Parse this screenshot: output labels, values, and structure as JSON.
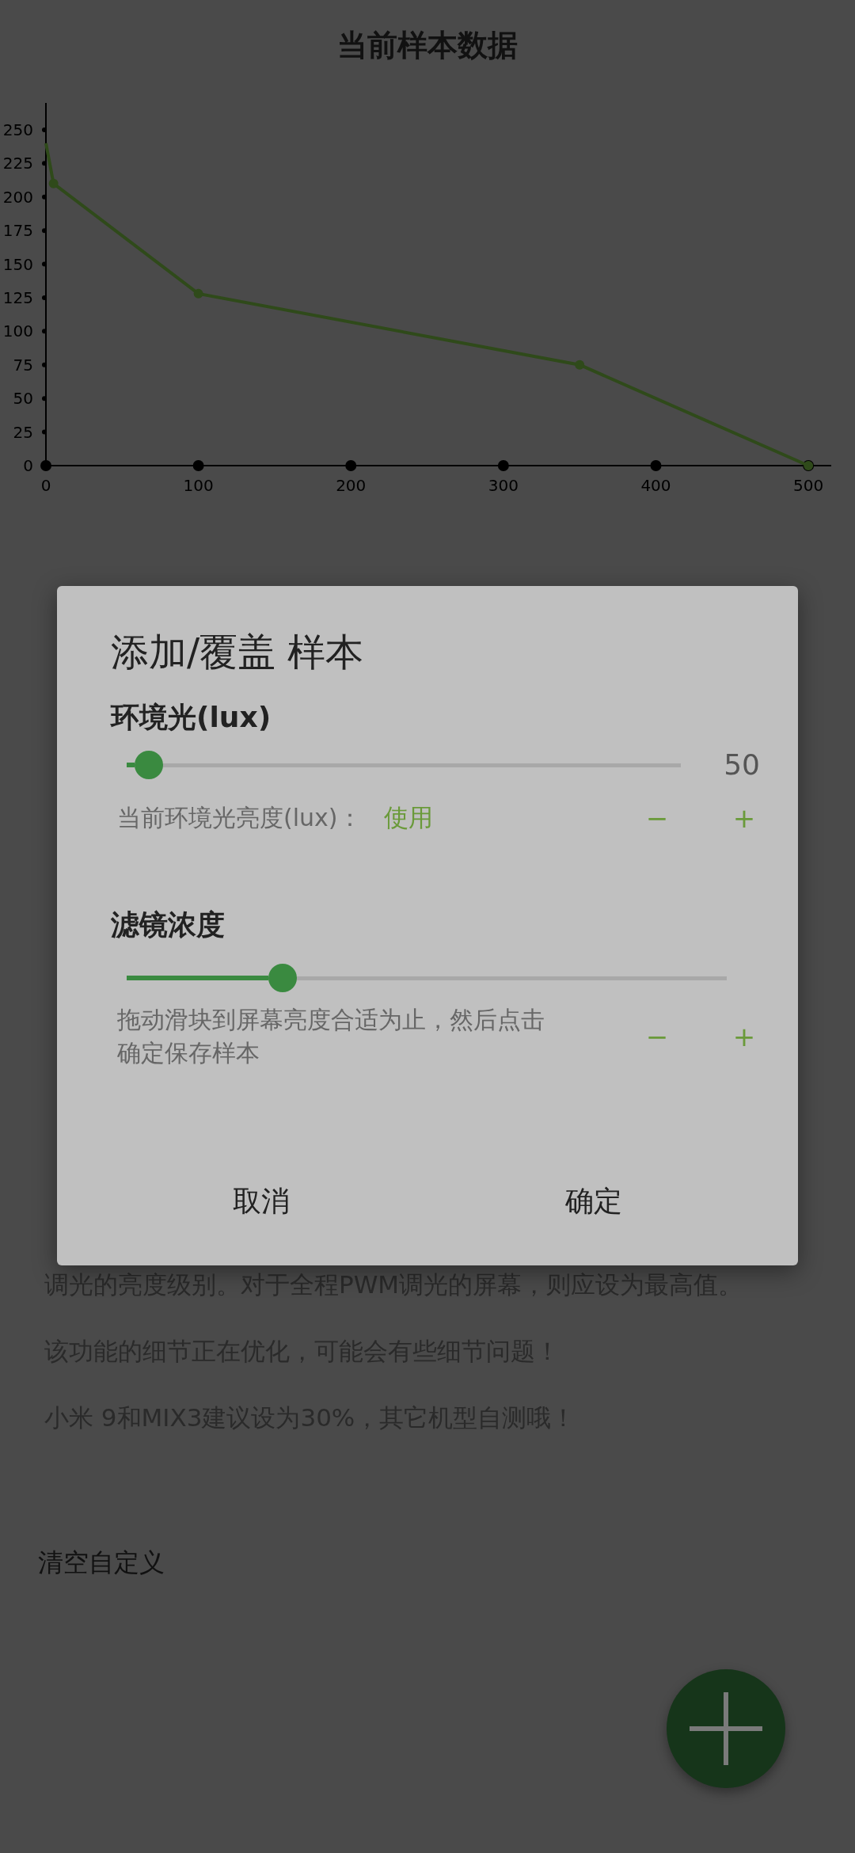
{
  "chart": {
    "title": "当前样本数据",
    "chart_data": {
      "type": "line",
      "x": [
        0,
        5,
        100,
        350,
        500
      ],
      "series": [
        {
          "color": "#2f4a1a",
          "marker": "circle",
          "values": [
            240,
            210,
            128,
            75,
            0
          ]
        }
      ],
      "xlim": [
        0,
        515
      ],
      "ylim": [
        0,
        270
      ],
      "xticks": [
        0,
        100,
        200,
        300,
        400,
        500
      ],
      "yticks": [
        0,
        25,
        50,
        75,
        100,
        125,
        150,
        175,
        200,
        225,
        250
      ]
    }
  },
  "background_text": {
    "partial_line": "调光的亮度级别。对于全程PWM调光的屏幕，则应设为最高值。",
    "paragraphs": [
      "该功能的细节正在优化，可能会有些细节问题！",
      "小米 9和MIX3建议设为30%，其它机型自测哦！"
    ],
    "clear_link": "清空自定义"
  },
  "dialog": {
    "title": "添加/覆盖 样本",
    "sections": [
      {
        "heading": "环境光(lux)",
        "level": 0.04,
        "value": "50",
        "caption": "当前环境光亮度(lux)：",
        "action": "使用",
        "minus": "−",
        "plus": "+"
      },
      {
        "heading": "滤镜浓度",
        "level": 0.26,
        "caption": "拖动滑块到屏幕亮度合适为止，然后点击确定保存样本",
        "minus": "−",
        "plus": "+"
      }
    ],
    "buttons": [
      "取消",
      "确定"
    ]
  }
}
